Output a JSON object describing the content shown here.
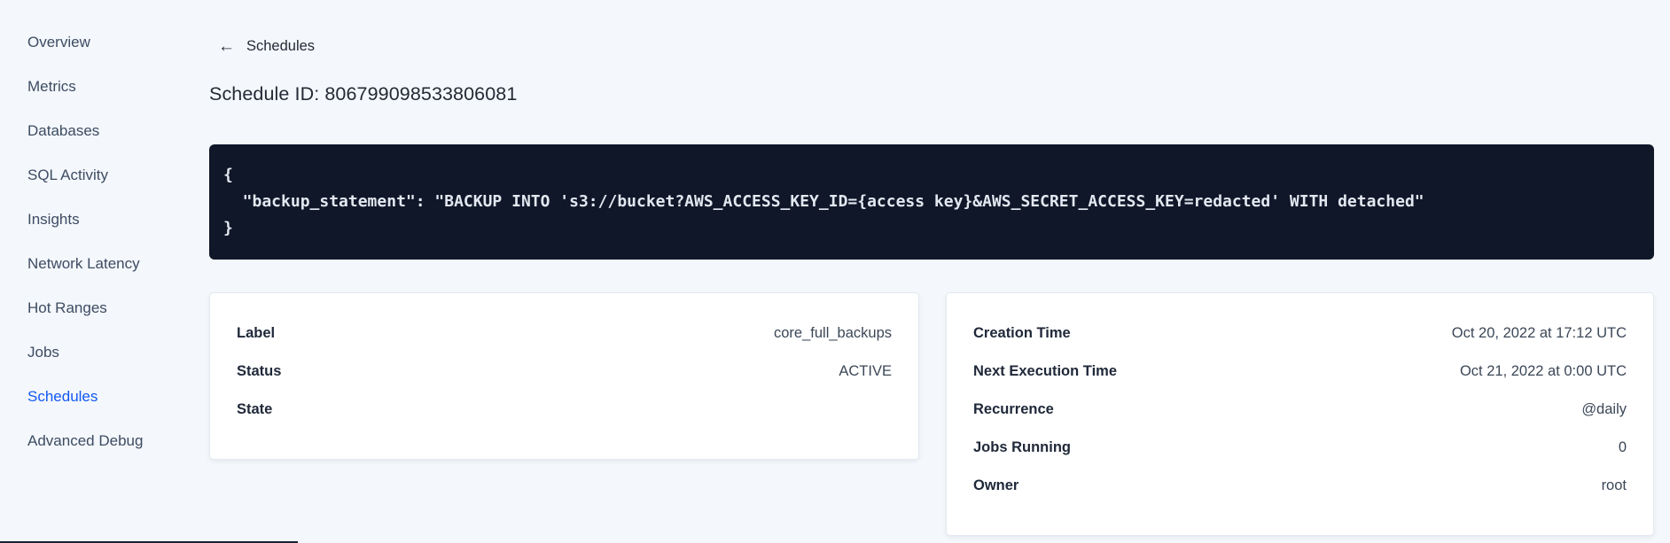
{
  "sidebar": {
    "items": [
      {
        "label": "Overview",
        "active": false
      },
      {
        "label": "Metrics",
        "active": false
      },
      {
        "label": "Databases",
        "active": false
      },
      {
        "label": "SQL Activity",
        "active": false
      },
      {
        "label": "Insights",
        "active": false
      },
      {
        "label": "Network Latency",
        "active": false
      },
      {
        "label": "Hot Ranges",
        "active": false
      },
      {
        "label": "Jobs",
        "active": false
      },
      {
        "label": "Schedules",
        "active": true
      },
      {
        "label": "Advanced Debug",
        "active": false
      }
    ]
  },
  "header": {
    "back_icon": "←",
    "back_label": "Schedules",
    "title": "Schedule ID: 806799098533806081"
  },
  "code_block": {
    "lines": [
      "{",
      "  \"backup_statement\": \"BACKUP INTO 's3://bucket?AWS_ACCESS_KEY_ID={access key}&AWS_SECRET_ACCESS_KEY=redacted' WITH detached\"",
      "}"
    ]
  },
  "cards": {
    "left": {
      "rows": [
        {
          "label": "Label",
          "value": "core_full_backups"
        },
        {
          "label": "Status",
          "value": "ACTIVE"
        },
        {
          "label": "State",
          "value": ""
        }
      ]
    },
    "right": {
      "rows": [
        {
          "label": "Creation Time",
          "value": "Oct 20, 2022 at 17:12 UTC"
        },
        {
          "label": "Next Execution Time",
          "value": "Oct 21, 2022 at 0:00 UTC"
        },
        {
          "label": "Recurrence",
          "value": "@daily"
        },
        {
          "label": "Jobs Running",
          "value": "0"
        },
        {
          "label": "Owner",
          "value": "root"
        }
      ]
    }
  },
  "colors": {
    "accent_blue": "#1158F5",
    "page_background": "#F4F7FB",
    "code_background": "#0F1729",
    "code_text": "#E3E8F0",
    "card_background": "#FFFFFF",
    "text_primary": "#242A35",
    "text_secondary": "#3D4C63"
  }
}
